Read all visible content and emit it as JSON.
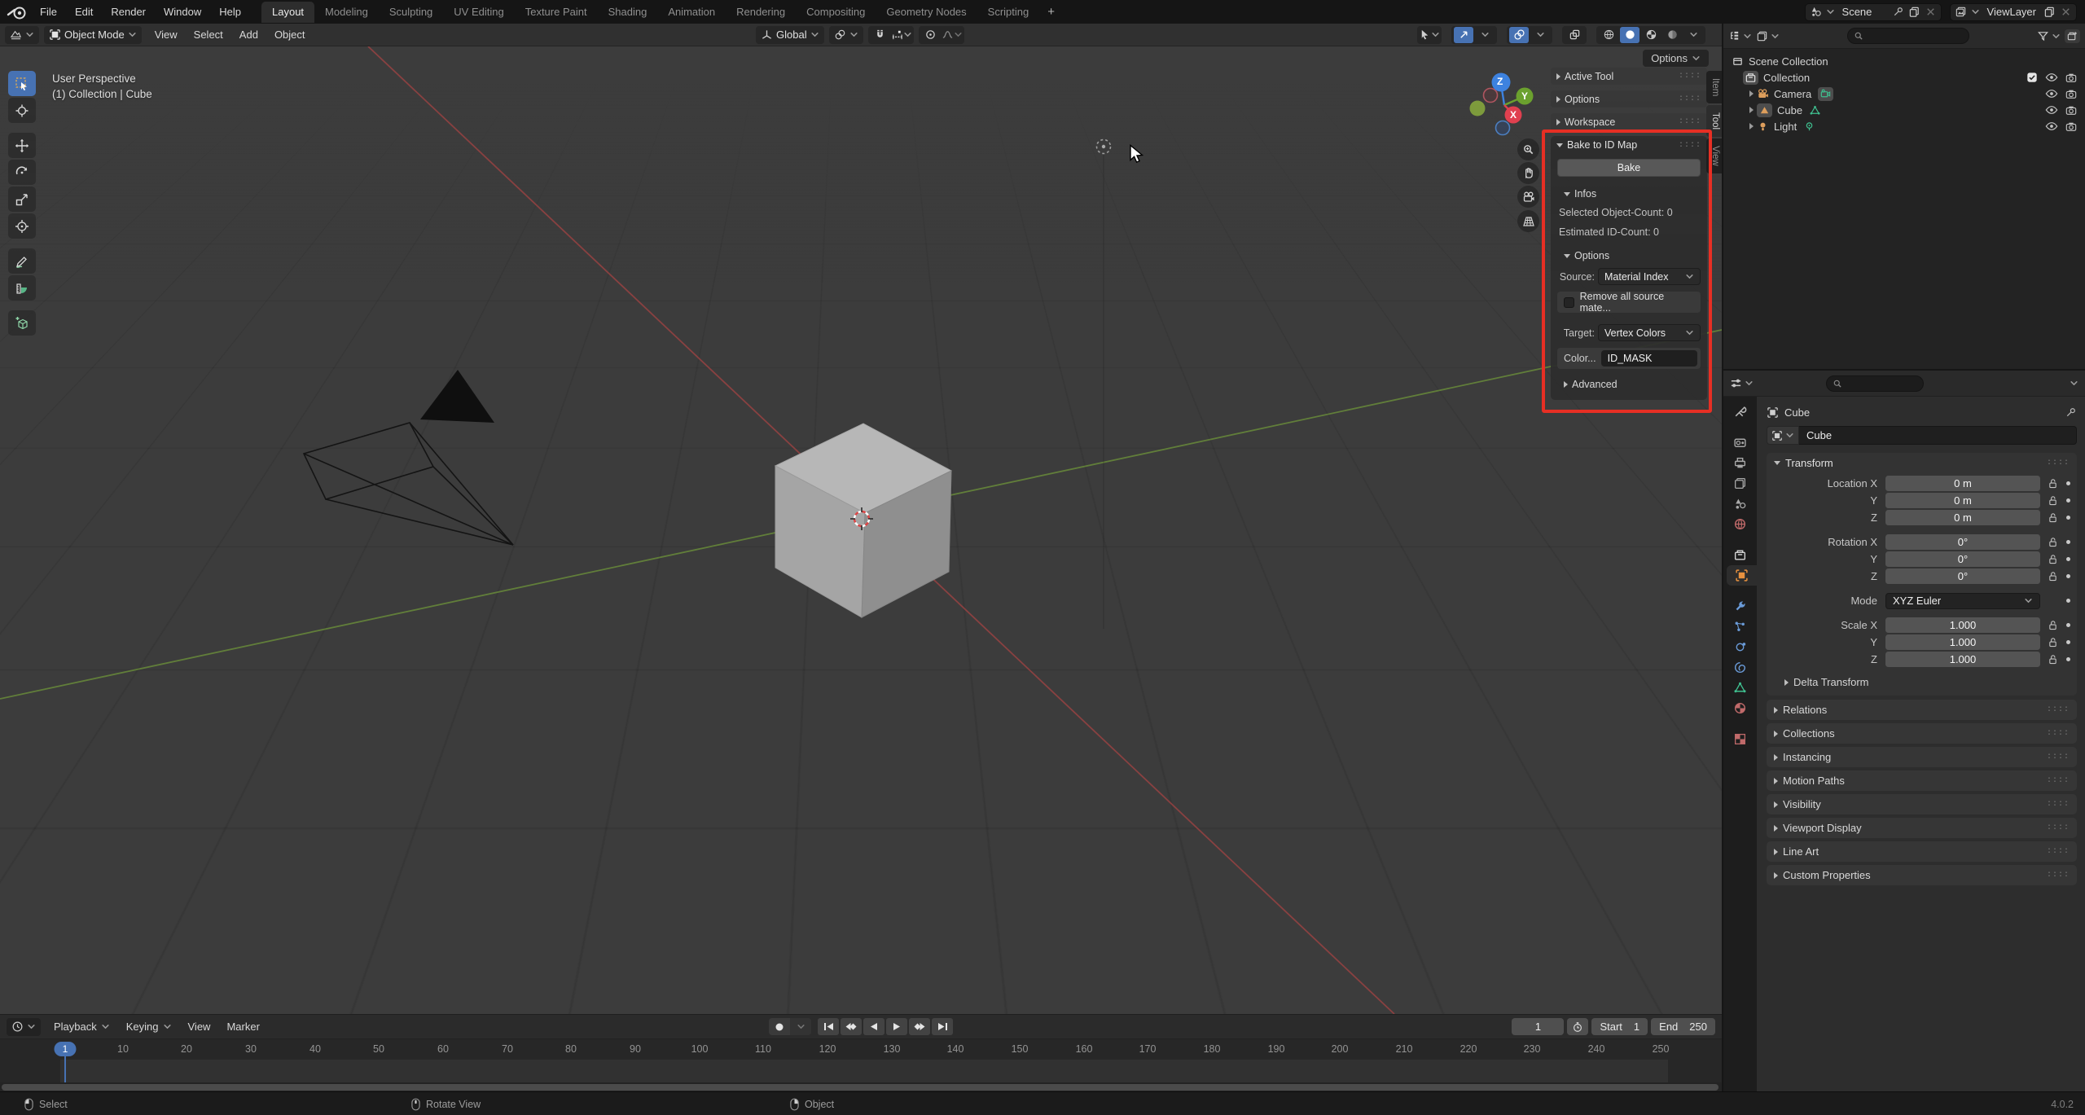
{
  "topbar": {
    "menus": [
      "File",
      "Edit",
      "Render",
      "Window",
      "Help"
    ],
    "workspaces": [
      "Layout",
      "Modeling",
      "Sculpting",
      "UV Editing",
      "Texture Paint",
      "Shading",
      "Animation",
      "Rendering",
      "Compositing",
      "Geometry Nodes",
      "Scripting"
    ],
    "add_workspace": "+",
    "scene": "Scene",
    "view_layer": "ViewLayer"
  },
  "header3d": {
    "mode": "Object Mode",
    "menus": [
      "View",
      "Select",
      "Add",
      "Object"
    ],
    "orientation": "Global",
    "options": "Options"
  },
  "viewport": {
    "view_label": "User Perspective",
    "context_label": "(1) Collection | Cube",
    "axis_x": "X",
    "axis_y": "Y",
    "axis_z": "Z"
  },
  "npanel": {
    "tabs": [
      "Item",
      "Tool",
      "View"
    ],
    "collapsed_panels": [
      "Active Tool",
      "Options",
      "Workspace"
    ],
    "bake": {
      "title": "Bake to ID Map",
      "bake_button": "Bake",
      "infos_title": "Infos",
      "selected_count": "Selected Object-Count: 0",
      "estimated_count": "Estimated ID-Count: 0",
      "options_title": "Options",
      "source_label": "Source:",
      "source_value": "Material Index",
      "remove_label": "Remove all source mate...",
      "target_label": "Target:",
      "target_value": "Vertex Colors",
      "color_label": "Color...",
      "color_value": "ID_MASK",
      "advanced_title": "Advanced"
    }
  },
  "outliner": {
    "rows": [
      {
        "label": "Scene Collection"
      },
      {
        "label": "Collection"
      },
      {
        "label": "Camera"
      },
      {
        "label": "Cube"
      },
      {
        "label": "Light"
      }
    ]
  },
  "properties": {
    "breadcrumb": "Cube",
    "name": "Cube",
    "transform_title": "Transform",
    "rows": [
      {
        "label": "Location X",
        "value": "0 m"
      },
      {
        "label": "Y",
        "value": "0 m"
      },
      {
        "label": "Z",
        "value": "0 m"
      },
      {
        "label": "Rotation X",
        "value": "0°"
      },
      {
        "label": "Y",
        "value": "0°"
      },
      {
        "label": "Z",
        "value": "0°"
      }
    ],
    "mode_label": "Mode",
    "mode_value": "XYZ Euler",
    "scale_rows": [
      {
        "label": "Scale X",
        "value": "1.000"
      },
      {
        "label": "Y",
        "value": "1.000"
      },
      {
        "label": "Z",
        "value": "1.000"
      }
    ],
    "sub_panel": "Delta Transform",
    "panels": [
      "Relations",
      "Collections",
      "Instancing",
      "Motion Paths",
      "Visibility",
      "Viewport Display",
      "Line Art",
      "Custom Properties"
    ]
  },
  "timeline": {
    "menus": [
      "Playback",
      "Keying",
      "View",
      "Marker"
    ],
    "current_frame": "1",
    "start_label": "Start",
    "start_value": "1",
    "end_label": "End",
    "end_value": "250",
    "ticks": [
      "10",
      "20",
      "30",
      "40",
      "50",
      "60",
      "70",
      "80",
      "90",
      "100",
      "110",
      "120",
      "130",
      "140",
      "150",
      "160",
      "170",
      "180",
      "190",
      "200",
      "210",
      "220",
      "230",
      "240",
      "250"
    ]
  },
  "statusbar": {
    "left": "Select",
    "middle": "Rotate View",
    "right": "Object",
    "version": "4.0.2"
  },
  "colors": {
    "accent_blue": "#4772b3",
    "annotation_red": "#e72f24",
    "axis_green": "#76a13a",
    "axis_red": "#a34343"
  }
}
